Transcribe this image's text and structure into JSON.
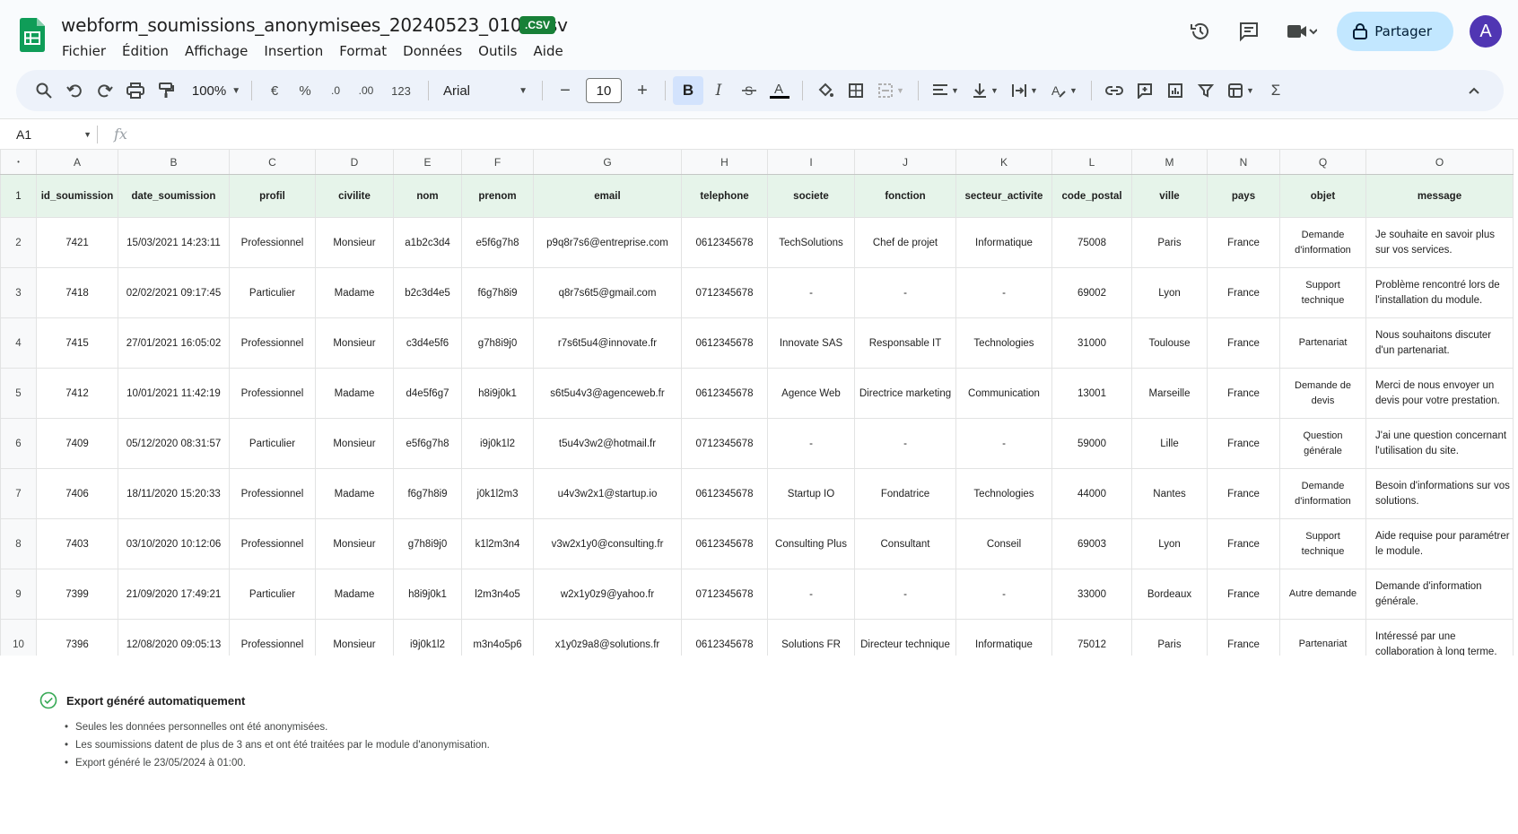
{
  "app": {
    "doc_title": "webform_soumissions_anonymisees_20240523_0100.csv",
    "file_badge": ".CSV",
    "menu": [
      "Fichier",
      "Édition",
      "Affichage",
      "Insertion",
      "Format",
      "Données",
      "Outils",
      "Aide"
    ],
    "share_label": "Partager",
    "avatar_initial": "A"
  },
  "toolbar": {
    "zoom": "100%",
    "currency": "€",
    "percent": "%",
    "dec_decrease": ".0",
    "dec_increase": ".00",
    "number_format": "123",
    "font": "Arial",
    "font_size": "10",
    "bold": "B",
    "italic": "I"
  },
  "formula_bar": {
    "cell_ref": "A1",
    "fx": "fx",
    "value": ""
  },
  "sheet": {
    "corner": "",
    "column_letters": [
      "A",
      "B",
      "C",
      "D",
      "E",
      "F",
      "G",
      "H",
      "I",
      "J",
      "K",
      "L",
      "M",
      "N",
      "Q",
      "O"
    ],
    "row_numbers": [
      "1",
      "2",
      "3",
      "4",
      "5",
      "6",
      "7",
      "8",
      "9",
      "10"
    ],
    "headers": [
      "id_soumission",
      "date_soumission",
      "profil",
      "civilite",
      "nom",
      "prenom",
      "email",
      "telephone",
      "societe",
      "fonction",
      "secteur_activite",
      "code_postal",
      "ville",
      "pays",
      "objet",
      "message"
    ],
    "rows": [
      [
        "7421",
        "15/03/2021 14:23:11",
        "Professionnel",
        "Monsieur",
        "a1b2c3d4",
        "e5f6g7h8",
        "p9q8r7s6@entreprise.com",
        "0612345678",
        "TechSolutions",
        "Chef de projet",
        "Informatique",
        "75008",
        "Paris",
        "France",
        "Demande d'information",
        "Je souhaite en savoir plus sur vos services."
      ],
      [
        "7418",
        "02/02/2021 09:17:45",
        "Particulier",
        "Madame",
        "b2c3d4e5",
        "f6g7h8i9",
        "q8r7s6t5@gmail.com",
        "0712345678",
        "-",
        "-",
        "-",
        "69002",
        "Lyon",
        "France",
        "Support technique",
        "Problème rencontré lors de l'installation du module."
      ],
      [
        "7415",
        "27/01/2021 16:05:02",
        "Professionnel",
        "Monsieur",
        "c3d4e5f6",
        "g7h8i9j0",
        "r7s6t5u4@innovate.fr",
        "0612345678",
        "Innovate SAS",
        "Responsable IT",
        "Technologies",
        "31000",
        "Toulouse",
        "France",
        "Partenariat",
        "Nous souhaitons discuter d'un partenariat."
      ],
      [
        "7412",
        "10/01/2021 11:42:19",
        "Professionnel",
        "Madame",
        "d4e5f6g7",
        "h8i9j0k1",
        "s6t5u4v3@agenceweb.fr",
        "0612345678",
        "Agence Web",
        "Directrice marketing",
        "Communication",
        "13001",
        "Marseille",
        "France",
        "Demande de devis",
        "Merci de nous envoyer un devis pour votre prestation."
      ],
      [
        "7409",
        "05/12/2020 08:31:57",
        "Particulier",
        "Monsieur",
        "e5f6g7h8",
        "i9j0k1l2",
        "t5u4v3w2@hotmail.fr",
        "0712345678",
        "-",
        "-",
        "-",
        "59000",
        "Lille",
        "France",
        "Question générale",
        "J'ai une question concernant l'utilisation du site."
      ],
      [
        "7406",
        "18/11/2020 15:20:33",
        "Professionnel",
        "Madame",
        "f6g7h8i9",
        "j0k1l2m3",
        "u4v3w2x1@startup.io",
        "0612345678",
        "Startup IO",
        "Fondatrice",
        "Technologies",
        "44000",
        "Nantes",
        "France",
        "Demande d'information",
        "Besoin d'informations sur vos solutions."
      ],
      [
        "7403",
        "03/10/2020 10:12:06",
        "Professionnel",
        "Monsieur",
        "g7h8i9j0",
        "k1l2m3n4",
        "v3w2x1y0@consulting.fr",
        "0612345678",
        "Consulting Plus",
        "Consultant",
        "Conseil",
        "69003",
        "Lyon",
        "France",
        "Support technique",
        "Aide requise pour paramétrer le module."
      ],
      [
        "7399",
        "21/09/2020 17:49:21",
        "Particulier",
        "Madame",
        "h8i9j0k1",
        "l2m3n4o5",
        "w2x1y0z9@yahoo.fr",
        "0712345678",
        "-",
        "-",
        "-",
        "33000",
        "Bordeaux",
        "France",
        "Autre demande",
        "Demande d'information générale."
      ],
      [
        "7396",
        "12/08/2020 09:05:13",
        "Professionnel",
        "Monsieur",
        "i9j0k1l2",
        "m3n4o5p6",
        "x1y0z9a8@solutions.fr",
        "0612345678",
        "Solutions FR",
        "Directeur technique",
        "Informatique",
        "75012",
        "Paris",
        "France",
        "Partenariat",
        "Intéressé par une collaboration à long terme."
      ]
    ]
  },
  "footer": {
    "title": "Export généré automatiquement",
    "notes": [
      "Seules les données personnelles ont été anonymisées.",
      "Les soumissions datent de plus de 3 ans et ont été traitées par le module d'anonymisation.",
      "Export généré le 23/05/2024 à 01:00."
    ]
  }
}
